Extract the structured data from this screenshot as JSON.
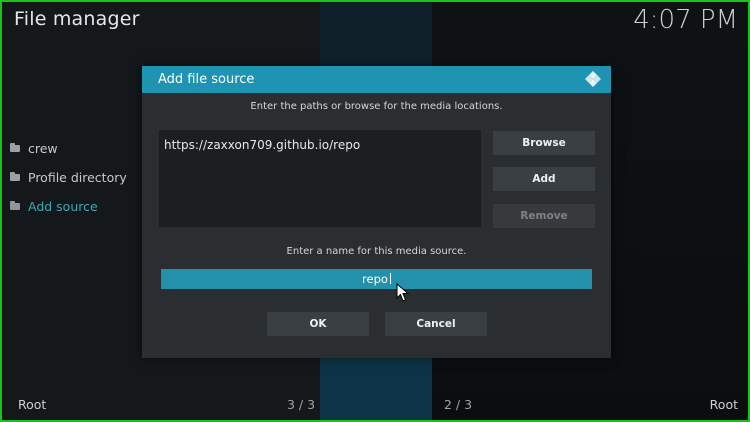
{
  "app": {
    "title": "File manager",
    "clock": "4:07 PM"
  },
  "sidebar": {
    "items": [
      {
        "label": "crew",
        "icon": "folder-icon"
      },
      {
        "label": "Profile directory",
        "icon": "folder-icon"
      },
      {
        "label": "Add source",
        "icon": "folder-icon",
        "active": true
      }
    ]
  },
  "footer": {
    "left_label": "Root",
    "right_label": "Root",
    "left_counter": "3 / 3",
    "right_counter": "2 / 3"
  },
  "dialog": {
    "title": "Add file source",
    "logo_icon": "kodi-logo-icon",
    "paths_instruction": "Enter the paths or browse for the media locations.",
    "path_value": "https://zaxxon709.github.io/repo",
    "browse_label": "Browse",
    "add_label": "Add",
    "remove_label": "Remove",
    "name_instruction": "Enter a name for this media source.",
    "name_value": "repo",
    "ok_label": "OK",
    "cancel_label": "Cancel"
  },
  "colors": {
    "accent": "#1f94b2",
    "input_active": "#2390ac",
    "active_text": "#3fa7b8",
    "dialog_bg": "#2a2e31",
    "button_bg": "#3a3f43",
    "frame_border": "#19c419"
  }
}
